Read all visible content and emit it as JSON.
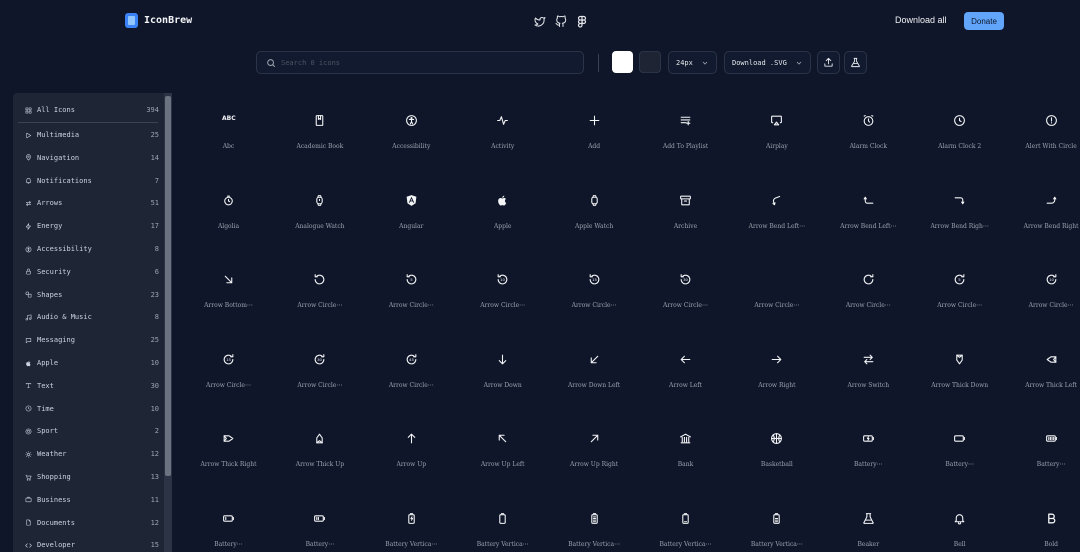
{
  "header": {
    "brand_name": "IconBrew",
    "social_icons": [
      "twitter-icon",
      "github-icon",
      "figma-icon"
    ],
    "download_all_label": "Download all",
    "donate_label": "Donate"
  },
  "toolbar": {
    "search_placeholder": "Search 0 icons",
    "color_swatches": [
      "#ffffff",
      "#1e2433"
    ],
    "size_value": "24px",
    "download_format_value": "Download .SVG",
    "upload_icon": "upload-icon",
    "flask_icon": "flask-icon"
  },
  "sidebar": {
    "items": [
      {
        "label": "All Icons",
        "count": "394",
        "icon": "grid-icon"
      },
      {
        "label": "Multimedia",
        "count": "25",
        "icon": "play-icon"
      },
      {
        "label": "Navigation",
        "count": "14",
        "icon": "map-pin-icon"
      },
      {
        "label": "Notifications",
        "count": "7",
        "icon": "bell-icon"
      },
      {
        "label": "Arrows",
        "count": "51",
        "icon": "arrows-icon"
      },
      {
        "label": "Energy",
        "count": "17",
        "icon": "bolt-icon"
      },
      {
        "label": "Accessibility",
        "count": "8",
        "icon": "accessibility-icon"
      },
      {
        "label": "Security",
        "count": "6",
        "icon": "lock-icon"
      },
      {
        "label": "Shapes",
        "count": "23",
        "icon": "shapes-icon"
      },
      {
        "label": "Audio & Music",
        "count": "8",
        "icon": "music-icon"
      },
      {
        "label": "Messaging",
        "count": "25",
        "icon": "message-icon"
      },
      {
        "label": "Apple",
        "count": "10",
        "icon": "apple-icon"
      },
      {
        "label": "Text",
        "count": "30",
        "icon": "text-icon"
      },
      {
        "label": "Time",
        "count": "10",
        "icon": "clock-icon"
      },
      {
        "label": "Sport",
        "count": "2",
        "icon": "ball-icon"
      },
      {
        "label": "Weather",
        "count": "12",
        "icon": "sun-icon"
      },
      {
        "label": "Shopping",
        "count": "13",
        "icon": "cart-icon"
      },
      {
        "label": "Business",
        "count": "11",
        "icon": "briefcase-icon"
      },
      {
        "label": "Documents",
        "count": "12",
        "icon": "document-icon"
      },
      {
        "label": "Developer",
        "count": "15",
        "icon": "code-icon"
      }
    ]
  },
  "grid": {
    "icons": [
      {
        "label": "Abc",
        "icon": "abc-icon",
        "glyph": "ABC"
      },
      {
        "label": "Academic Book",
        "icon": "book-icon"
      },
      {
        "label": "Accessibility",
        "icon": "accessibility-icon"
      },
      {
        "label": "Activity",
        "icon": "activity-icon"
      },
      {
        "label": "Add",
        "icon": "plus-icon"
      },
      {
        "label": "Add To Playlist",
        "icon": "playlist-add-icon"
      },
      {
        "label": "Airplay",
        "icon": "airplay-icon"
      },
      {
        "label": "Alarm Clock",
        "icon": "alarm-clock-icon"
      },
      {
        "label": "Alarm Clock 2",
        "icon": "alarm-clock-2-icon"
      },
      {
        "label": "Alert With Circle",
        "icon": "alert-circle-icon"
      },
      {
        "label": "Algolia",
        "icon": "algolia-icon"
      },
      {
        "label": "Analogue Watch",
        "icon": "watch-icon"
      },
      {
        "label": "Angular",
        "icon": "angular-icon"
      },
      {
        "label": "Apple",
        "icon": "apple-icon"
      },
      {
        "label": "Apple Watch",
        "icon": "apple-watch-icon"
      },
      {
        "label": "Archive",
        "icon": "archive-icon"
      },
      {
        "label": "Arrow Bend Left⋯",
        "icon": "arrow-bend-left-down-icon"
      },
      {
        "label": "Arrow Bend Left⋯",
        "icon": "arrow-bend-left-up-icon"
      },
      {
        "label": "Arrow Bend Righ⋯",
        "icon": "arrow-bend-right-down-icon"
      },
      {
        "label": "Arrow Bend Right",
        "icon": "arrow-bend-right-up-icon"
      },
      {
        "label": "Arrow Bottom⋯",
        "icon": "arrow-bottom-right-icon"
      },
      {
        "label": "Arrow Circle⋯",
        "icon": "arrow-circle-left-icon"
      },
      {
        "label": "Arrow Circle⋯",
        "icon": "arrow-circle-5-icon"
      },
      {
        "label": "Arrow Circle⋯",
        "icon": "arrow-circle-10-icon"
      },
      {
        "label": "Arrow Circle⋯",
        "icon": "arrow-circle-15-icon"
      },
      {
        "label": "Arrow Circle⋯",
        "icon": "arrow-circle-30-icon"
      },
      {
        "label": "Arrow Circle⋯",
        "icon": "arrow-circle-blank-icon"
      },
      {
        "label": "Arrow Circle⋯",
        "icon": "arrow-circle-right-icon"
      },
      {
        "label": "Arrow Circle⋯",
        "icon": "arrow-circle-forward-5-icon"
      },
      {
        "label": "Arrow Circle⋯",
        "icon": "arrow-circle-forward-10-icon"
      },
      {
        "label": "Arrow Circle⋯",
        "icon": "arrow-circle-forward-15-icon"
      },
      {
        "label": "Arrow Circle⋯",
        "icon": "arrow-circle-forward-30-icon"
      },
      {
        "label": "Arrow Circle⋯",
        "icon": "arrow-circle-forward-45-icon"
      },
      {
        "label": "Arrow Down",
        "icon": "arrow-down-icon"
      },
      {
        "label": "Arrow Down Left",
        "icon": "arrow-down-left-icon"
      },
      {
        "label": "Arrow Left",
        "icon": "arrow-left-icon"
      },
      {
        "label": "Arrow Right",
        "icon": "arrow-right-icon"
      },
      {
        "label": "Arrow Switch",
        "icon": "arrow-switch-icon"
      },
      {
        "label": "Arrow Thick Down",
        "icon": "arrow-thick-down-icon"
      },
      {
        "label": "Arrow Thick Left",
        "icon": "arrow-thick-left-icon"
      },
      {
        "label": "Arrow Thick Right",
        "icon": "arrow-thick-right-icon"
      },
      {
        "label": "Arrow Thick Up",
        "icon": "arrow-thick-up-icon"
      },
      {
        "label": "Arrow Up",
        "icon": "arrow-up-icon"
      },
      {
        "label": "Arrow Up Left",
        "icon": "arrow-up-left-icon"
      },
      {
        "label": "Arrow Up Right",
        "icon": "arrow-up-right-icon"
      },
      {
        "label": "Bank",
        "icon": "bank-icon"
      },
      {
        "label": "Basketball",
        "icon": "basketball-icon"
      },
      {
        "label": "Battery⋯",
        "icon": "battery-charging-icon"
      },
      {
        "label": "Battery⋯",
        "icon": "battery-empty-icon"
      },
      {
        "label": "Battery⋯",
        "icon": "battery-full-icon"
      },
      {
        "label": "Battery⋯",
        "icon": "battery-low-icon"
      },
      {
        "label": "Battery⋯",
        "icon": "battery-medium-icon"
      },
      {
        "label": "Battery Vertica⋯",
        "icon": "battery-vertical-charging-icon"
      },
      {
        "label": "Battery Vertica⋯",
        "icon": "battery-vertical-empty-icon"
      },
      {
        "label": "Battery Vertica⋯",
        "icon": "battery-vertical-full-icon"
      },
      {
        "label": "Battery Vertica⋯",
        "icon": "battery-vertical-low-icon"
      },
      {
        "label": "Battery Vertica⋯",
        "icon": "battery-vertical-medium-icon"
      },
      {
        "label": "Beaker",
        "icon": "beaker-icon"
      },
      {
        "label": "Bell",
        "icon": "bell-icon"
      },
      {
        "label": "Bold",
        "icon": "bold-icon"
      }
    ]
  }
}
